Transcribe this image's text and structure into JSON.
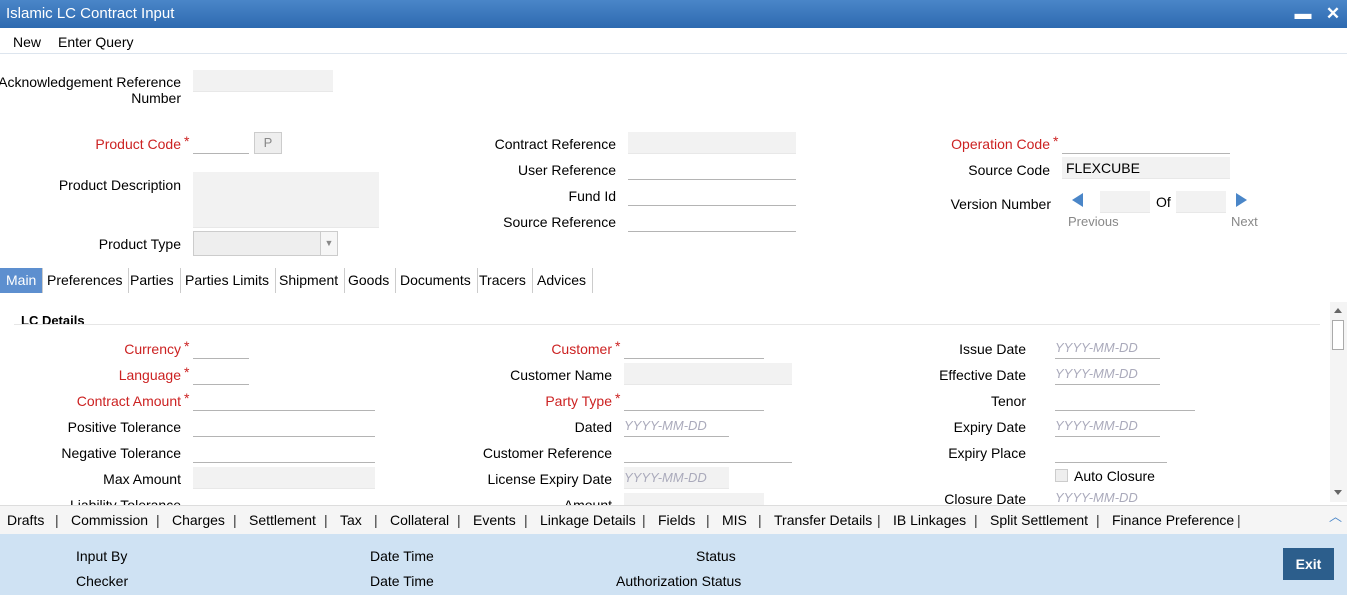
{
  "window": {
    "title": "Islamic LC Contract Input",
    "minimize": "▬",
    "close": "✕"
  },
  "menu": {
    "new": "New",
    "enter_query": "Enter Query"
  },
  "header": {
    "ack_ref_line1": "Acknowledgement Reference",
    "ack_ref_line2": "Number",
    "product_code": "Product Code",
    "p_button": "P",
    "product_description": "Product Description",
    "product_type": "Product Type",
    "contract_reference": "Contract Reference",
    "user_reference": "User Reference",
    "fund_id": "Fund Id",
    "source_reference": "Source Reference",
    "operation_code": "Operation Code",
    "source_code": "Source Code",
    "source_code_value": "FLEXCUBE",
    "version_number": "Version Number",
    "of": "Of",
    "previous": "Previous",
    "next": "Next",
    "required_marker": "*"
  },
  "tabs": [
    "Main",
    "Preferences",
    "Parties",
    "Parties Limits",
    "Shipment",
    "Goods",
    "Documents",
    "Tracers",
    "Advices"
  ],
  "lc_details": {
    "title": "LC Details",
    "currency": "Currency",
    "language": "Language",
    "contract_amount": "Contract Amount",
    "positive_tolerance": "Positive Tolerance",
    "negative_tolerance": "Negative Tolerance",
    "max_amount": "Max Amount",
    "liability_tolerance": "Liability Tolerance",
    "customer": "Customer",
    "customer_name": "Customer Name",
    "party_type": "Party Type",
    "dated": "Dated",
    "customer_reference": "Customer Reference",
    "license_expiry_date": "License Expiry Date",
    "amount": "Amount",
    "issue_date": "Issue Date",
    "effective_date": "Effective Date",
    "tenor": "Tenor",
    "expiry_date": "Expiry Date",
    "expiry_place": "Expiry Place",
    "auto_closure": "Auto Closure",
    "closure_date": "Closure Date",
    "date_placeholder": "YYYY-MM-DD"
  },
  "bottom_links": [
    "Drafts",
    "Commission",
    "Charges",
    "Settlement",
    "Tax",
    "Collateral",
    "Events",
    "Linkage Details",
    "Fields",
    "MIS",
    "Transfer Details",
    "IB Linkages",
    "Split Settlement",
    "Finance Preference"
  ],
  "footer": {
    "input_by": "Input By",
    "checker": "Checker",
    "date_time": "Date Time",
    "status": "Status",
    "authorization_status": "Authorization Status",
    "exit": "Exit"
  }
}
